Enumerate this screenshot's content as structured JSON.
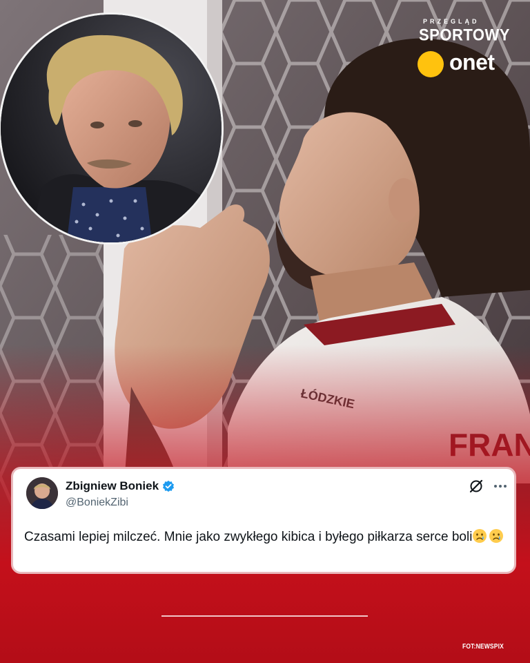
{
  "brand": {
    "top_word": "PRZEGLĄD",
    "main_word": "SPORTOWY",
    "sub_word": "onet",
    "dot_color": "#ffc20e"
  },
  "photo": {
    "subject": "player-kit-lettering",
    "kit_text": "FRAN",
    "sponsor_text": "ŁÓDZKIE"
  },
  "post": {
    "author_name": "Zbigniew Boniek",
    "handle": "@BoniekZibi",
    "text": "Czasami lepiej milczeć. Mnie jako zwykłego kibica i byłego piłkarza serce boli",
    "emojis": [
      "crying-face-emoji",
      "crying-face-emoji"
    ],
    "verified_color": "#1d9bf0",
    "icons": [
      "grok-icon",
      "more-icon"
    ]
  },
  "credit": "FOT:NEWSPIX",
  "colors": {
    "accent_red": "#c4101b",
    "card_border": "#e9b9bc"
  }
}
